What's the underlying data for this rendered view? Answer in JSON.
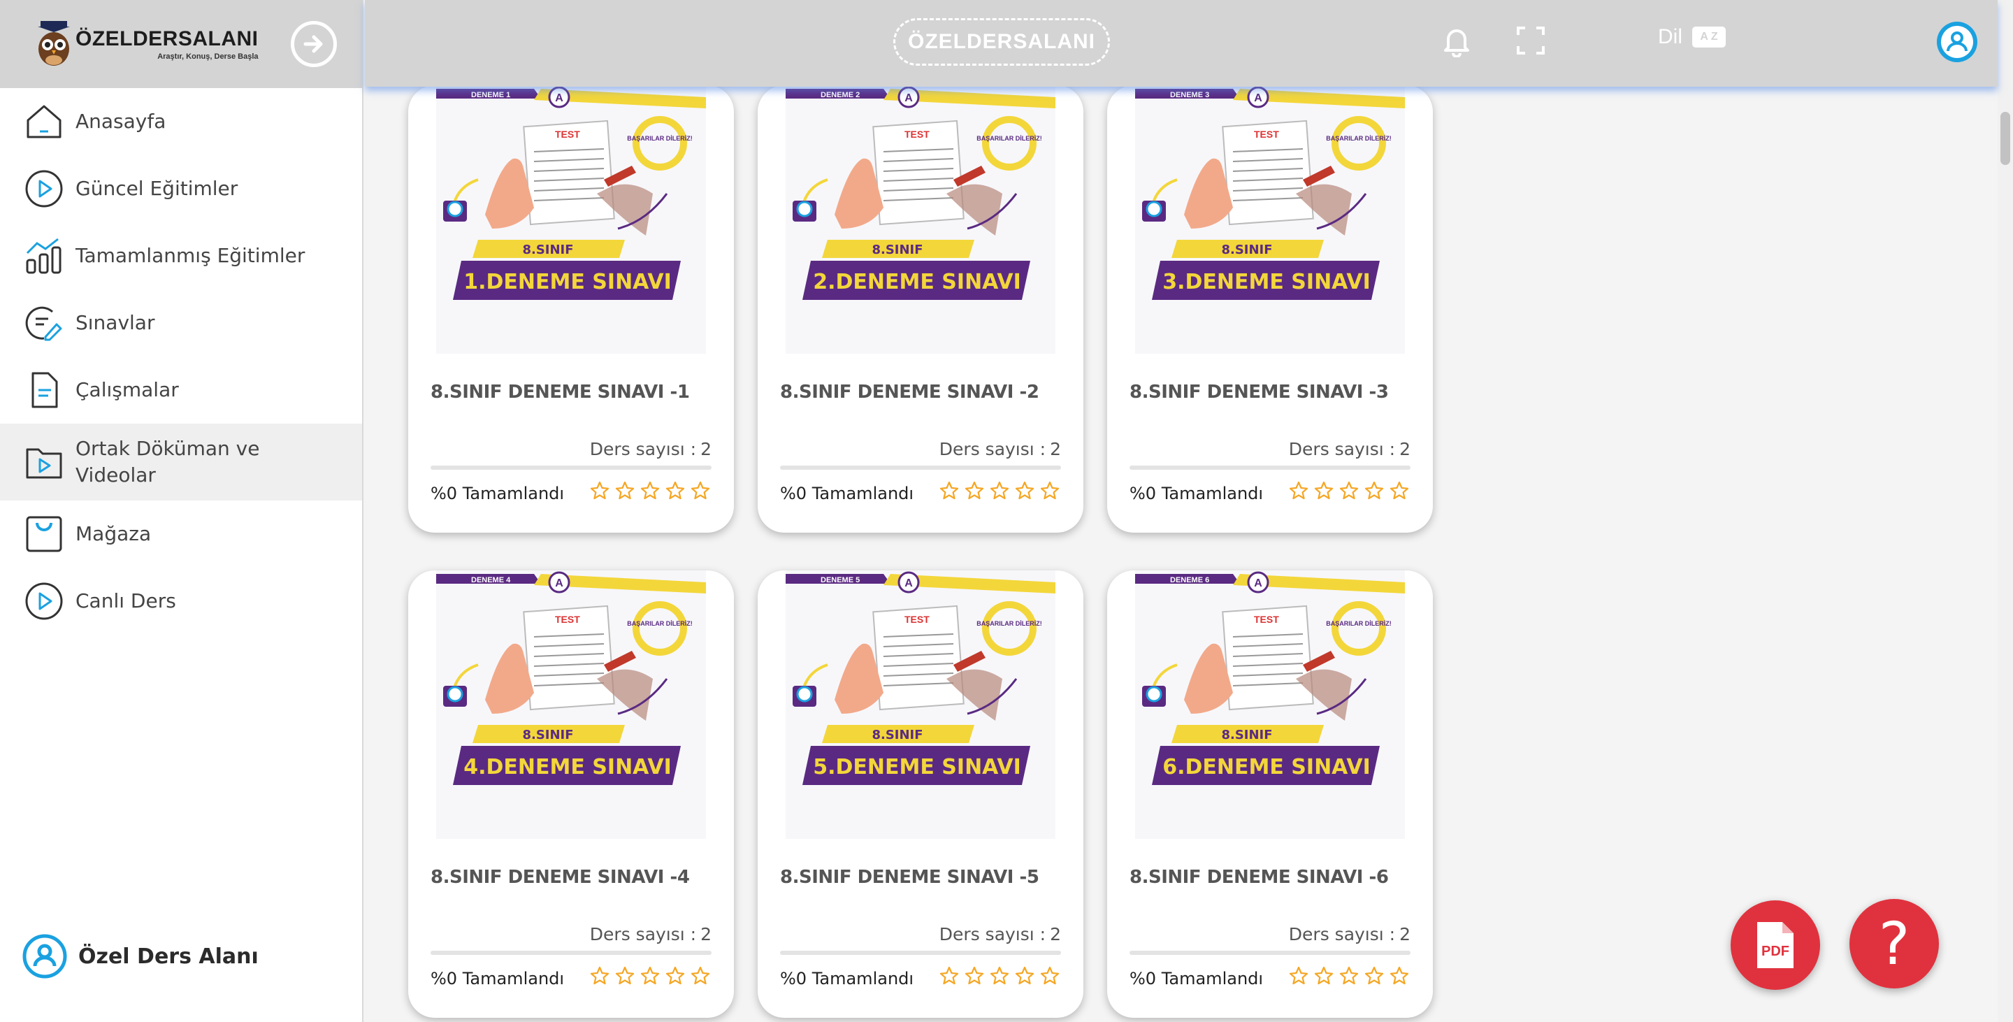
{
  "brand": {
    "title": "ÖZELDERSALANI",
    "subtitle": "Araştır, Konuş, Derse Başla"
  },
  "topbar": {
    "title": "ÖZELDERSALANI",
    "lang_label": "Dil",
    "lang_badge": "A Z"
  },
  "sidebar": {
    "items": [
      {
        "label": "Anasayfa",
        "icon": "home-icon"
      },
      {
        "label": "Güncel Eğitimler",
        "icon": "play-circle-icon"
      },
      {
        "label": "Tamamlanmış Eğitimler",
        "icon": "bar-chart-icon"
      },
      {
        "label": "Sınavlar",
        "icon": "exam-edit-icon"
      },
      {
        "label": "Çalışmalar",
        "icon": "document-icon"
      },
      {
        "label": "Ortak Döküman ve Videolar",
        "icon": "video-folder-icon",
        "active": true
      },
      {
        "label": "Mağaza",
        "icon": "shopping-bag-icon"
      },
      {
        "label": "Canlı Ders",
        "icon": "live-play-icon"
      }
    ],
    "user": "Özel Ders Alanı"
  },
  "colors": {
    "accent_blue": "#1aa1e0",
    "fab_red": "#e0323e",
    "star_orange": "#f5a623",
    "banner_purple": "#5a2a82",
    "banner_yellow": "#f3d63a"
  },
  "cards": [
    {
      "badge": "DENEME 1",
      "grade": "8.SINIF",
      "exam": "1.DENEME SINAVI",
      "title": "8.SINIF DENEME SINAVI -1",
      "count_label": "Ders sayısı :",
      "count": "2",
      "status": "%0 Tamamlandı",
      "progress": 0,
      "rating": 0
    },
    {
      "badge": "DENEME 2",
      "grade": "8.SINIF",
      "exam": "2.DENEME SINAVI",
      "title": "8.SINIF DENEME SINAVI -2",
      "count_label": "Ders sayısı :",
      "count": "2",
      "status": "%0 Tamamlandı",
      "progress": 0,
      "rating": 0
    },
    {
      "badge": "DENEME 3",
      "grade": "8.SINIF",
      "exam": "3.DENEME SINAVI",
      "title": "8.SINIF DENEME SINAVI -3",
      "count_label": "Ders sayısı :",
      "count": "2",
      "status": "%0 Tamamlandı",
      "progress": 0,
      "rating": 0
    },
    {
      "badge": "DENEME 4",
      "grade": "8.SINIF",
      "exam": "4.DENEME SINAVI",
      "title": "8.SINIF DENEME SINAVI -4",
      "count_label": "Ders sayısı :",
      "count": "2",
      "status": "%0 Tamamlandı",
      "progress": 0,
      "rating": 0
    },
    {
      "badge": "DENEME 5",
      "grade": "8.SINIF",
      "exam": "5.DENEME SINAVI",
      "title": "8.SINIF DENEME SINAVI -5",
      "count_label": "Ders sayısı :",
      "count": "2",
      "status": "%0 Tamamlandı",
      "progress": 0,
      "rating": 0
    },
    {
      "badge": "DENEME 6",
      "grade": "8.SINIF",
      "exam": "6.DENEME SINAVI",
      "title": "8.SINIF DENEME SINAVI -6",
      "count_label": "Ders sayısı :",
      "count": "2",
      "status": "%0 Tamamlandı",
      "progress": 0,
      "rating": 0
    }
  ],
  "thumb_text": {
    "test": "TEST",
    "success": "BAŞARILAR DİLERİZ!",
    "letter": "A"
  },
  "fabs": {
    "pdf": "PDF",
    "help": "?"
  }
}
